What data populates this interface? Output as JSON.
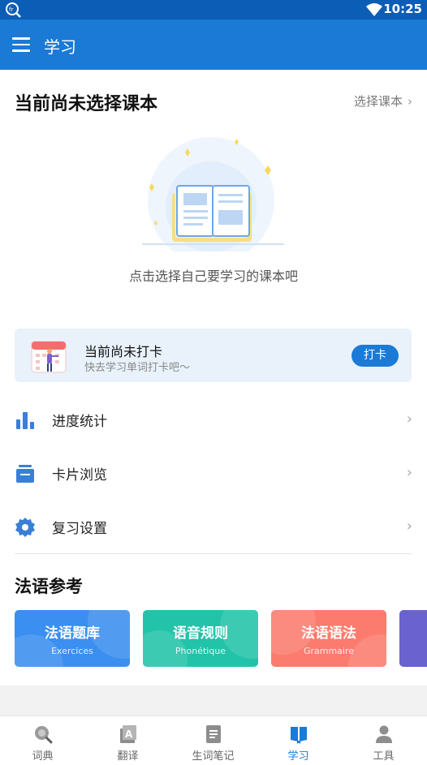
{
  "status_bar": {
    "time": "10:25"
  },
  "app_bar": {
    "title": "学习"
  },
  "textbook": {
    "title": "当前尚未选择课本",
    "select_label": "选择课本",
    "empty_hint": "点击选择自己要学习的课本吧"
  },
  "checkin": {
    "title": "当前尚未打卡",
    "subtitle": "快去学习单词打卡吧〜",
    "button": "打卡"
  },
  "menu": [
    {
      "label": "进度统计",
      "icon": "bar-chart-icon"
    },
    {
      "label": "卡片浏览",
      "icon": "cards-icon"
    },
    {
      "label": "复习设置",
      "icon": "gear-icon"
    }
  ],
  "reference": {
    "title": "法语参考",
    "cards": [
      {
        "title": "法语题库",
        "subtitle": "Exercices",
        "color": "#3a8ff0"
      },
      {
        "title": "语音规则",
        "subtitle": "Phonétique",
        "color": "#22c3a9"
      },
      {
        "title": "法语语法",
        "subtitle": "Grammaire",
        "color": "#fb7c6e"
      },
      {
        "title": "",
        "subtitle": "",
        "color": "#6a63cf"
      }
    ]
  },
  "bottom_nav": [
    {
      "label": "词典",
      "icon": "dictionary-search-icon",
      "active": false
    },
    {
      "label": "翻译",
      "icon": "translate-icon",
      "active": false
    },
    {
      "label": "生词笔记",
      "icon": "notebook-icon",
      "active": false
    },
    {
      "label": "学习",
      "icon": "book-icon",
      "active": true
    },
    {
      "label": "工具",
      "icon": "person-icon",
      "active": false
    }
  ],
  "colors": {
    "primary": "#1a7ad6",
    "status_bar": "#0c5db5",
    "checkin_bg": "#e9f2fb"
  }
}
